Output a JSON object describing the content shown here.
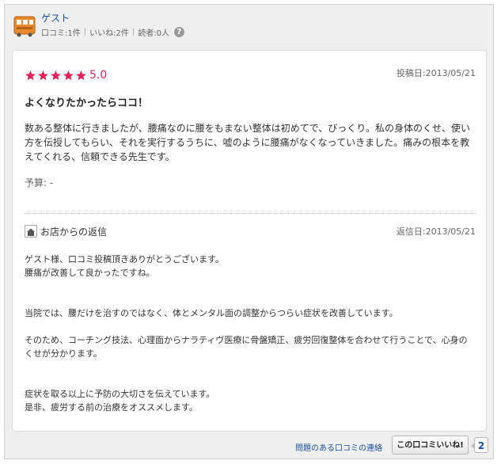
{
  "user": {
    "name": "ゲスト",
    "stats": [
      "口コミ:1件",
      "いいね:2件",
      "読者:0人"
    ],
    "help_icon": "?"
  },
  "review": {
    "rating": 5.0,
    "rating_text": "5.0",
    "star_color": "#e8245a",
    "posted_at": "投稿日:2013/05/21",
    "title": "よくなりたかったらココ！",
    "body": "数ある整体に行きましたが、腰痛なのに腰をもまない整体は初めてで、びっくり。私の身体のくせ、使い方を伝授してもらい、それを実行するうちに、嘘のように腰痛がなくなっていきました。痛みの根本を教えてくれる、信頼できる先生です。",
    "budget": "予算: -"
  },
  "reply": {
    "label": "お店からの返信",
    "replied_at": "返信日:2013/05/21",
    "paragraphs": [
      "ゲスト様、口コミ投稿頂きありがとうございます。\n腰痛が改善して良かったですね。",
      "当院では、腰だけを治すのではなく、体とメンタル面の調整からつらい症状を改善しています。",
      "そのため、コーチング技法、心理面からナラティヴ医療に骨盤矯正、疲労回復整体を合わせて行うことで、心身のくせが分かります。",
      "症状を取る以上に予防の大切さを伝えています。\n是非、疲労する前の治療をオススメします。"
    ]
  },
  "footer": {
    "report_link": "問題のある口コミの連絡",
    "like_button": "この口コミいいね!",
    "like_count": "2"
  }
}
